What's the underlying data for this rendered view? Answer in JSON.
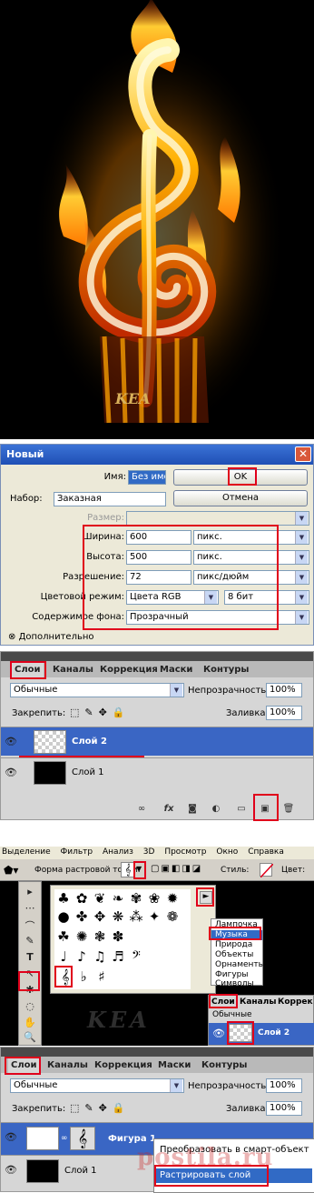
{
  "watermark": {
    "fire": "KEA",
    "screen": "KEA",
    "site": "postila.ru"
  },
  "dialog": {
    "title": "Новый",
    "close_label": "✕",
    "name_label": "Имя:",
    "name_value": "Без имени",
    "ok_label": "OK",
    "cancel_label": "Отмена",
    "preset_label": "Набор:",
    "preset_value": "Заказная",
    "size_label": "Размер:",
    "width_label": "Ширина:",
    "width_value": "600",
    "width_unit": "пикс.",
    "height_label": "Высота:",
    "height_value": "500",
    "height_unit": "пикс.",
    "resolution_label": "Разрешение:",
    "resolution_value": "72",
    "resolution_unit": "пикс/дюйм",
    "mode_label": "Цветовой режим:",
    "mode_value": "Цвета RGB",
    "bits_value": "8 бит",
    "bg_label": "Содержимое фона:",
    "bg_value": "Прозрачный",
    "advanced_label": "Дополнительно"
  },
  "layers1": {
    "tabs": [
      "Слои",
      "Каналы",
      "Коррекция",
      "Маски",
      "Контуры"
    ],
    "blend_mode": "Обычные",
    "opacity_label": "Непрозрачность:",
    "opacity_value": "100%",
    "lock_label": "Закрепить:",
    "fill_label": "Заливка:",
    "fill_value": "100%",
    "layers": [
      "Слой 2",
      "Слой 1"
    ],
    "bottom_icons": [
      "∞",
      "fx",
      "◙",
      "◐",
      "▭",
      "▣",
      "🗑"
    ]
  },
  "tools": {
    "menu": [
      "Выделение",
      "Фильтр",
      "Анализ",
      "3D",
      "Просмотр",
      "Окно",
      "Справка"
    ],
    "options_label": "Форма растровой точки:",
    "style_label": "Стиль:",
    "color_label": "Цвет:",
    "categories": [
      "Лампочка",
      "Музыка",
      "Природа",
      "Объекты",
      "Орнаменты",
      "Фигуры",
      "Символы"
    ],
    "mini_tabs": [
      "Слои",
      "Каналы",
      "Коррек"
    ],
    "mini_blend": "Обычные",
    "mini_layer": "Слой 2",
    "tool_icons": [
      "▸",
      "⋯",
      "⌒",
      "✎",
      "T",
      "↖",
      "✱",
      "◌",
      "✋",
      "🔍"
    ],
    "shape_glyphs": [
      "♣",
      "✿",
      "❦",
      "❧",
      "✾",
      "❀",
      "✹",
      "●",
      "✤",
      "✥",
      "❋",
      "⁂",
      "✦",
      "❁",
      "☘",
      "✺",
      "❃",
      "✽",
      "♩",
      "♪",
      "♫",
      "♬",
      "𝄢",
      "𝄞",
      "♭",
      "♯"
    ]
  },
  "layers2": {
    "tabs": [
      "Слои",
      "Каналы",
      "Коррекция",
      "Маски",
      "Контуры"
    ],
    "blend_mode": "Обычные",
    "opacity_label": "Непрозрачность:",
    "opacity_value": "100%",
    "lock_label": "Закрепить:",
    "fill_label": "Заливка:",
    "fill_value": "100%",
    "layers": [
      "Фигура 1",
      "Слой 1"
    ],
    "context_menu": [
      "Преобразовать в смарт-объект",
      "Растрировать слой"
    ]
  }
}
